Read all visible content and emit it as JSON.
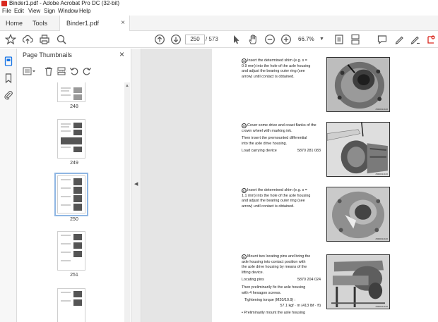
{
  "window": {
    "title": "Binder1.pdf - Adobe Acrobat Pro DC (32-bit)"
  },
  "menu": [
    "File",
    "Edit",
    "View",
    "Sign",
    "Window",
    "Help"
  ],
  "tabs": {
    "home": "Home",
    "tools": "Tools",
    "document": "Binder1.pdf",
    "close_glyph": "×"
  },
  "toolbar": {
    "current_page": "250",
    "total_pages": "/ 573",
    "zoom": "66.7%",
    "icons": [
      "star-icon",
      "upload-icon",
      "print-icon",
      "search-icon",
      "page-up-icon",
      "page-down-icon",
      "select-cursor-icon",
      "hand-icon",
      "zoom-out-icon",
      "zoom-in-icon",
      "fit-page-icon",
      "scroll-mode-icon",
      "comment-icon",
      "highlight-icon",
      "sign-icon",
      "share-icon"
    ]
  },
  "sidebar": {
    "title": "Page Thumbnails",
    "close_glyph": "×",
    "thumbnails": [
      {
        "label": "248"
      },
      {
        "label": "249"
      },
      {
        "label": "250",
        "selected": true
      },
      {
        "label": "251"
      },
      {
        "label": ""
      }
    ]
  },
  "document": {
    "steps": [
      {
        "number": "38",
        "lines": [
          "Insert the determined shim (e.g. s =",
          "0.9 mm) into the hole of the axle housing",
          "and adjust the bearing outer ring (see",
          "arrow) until contact is obtained."
        ],
        "photo_code": "ZSB0014100"
      },
      {
        "number": "39",
        "lines": [
          "Cover some drive and coast flanks of the",
          "crown wheel with marking ink."
        ],
        "para2": [
          "Then insert the premounted differential",
          "into the axle drive housing."
        ],
        "device_label": "Load carrying device",
        "device_value": "5870 281 083",
        "photo_code": "ZSB0014100"
      },
      {
        "number": "40",
        "lines": [
          "Insert the determined shim (e.g. s =",
          "1.1 mm) into the hole of the axle housing",
          "and adjust the bearing outer ring (see",
          "arrow) until contact is obtained."
        ],
        "photo_code": "ZSB0014100"
      },
      {
        "number": "41",
        "lines": [
          "Mount two locating pins and bring the",
          "axle housing into contact position with",
          "the axle drive housing by means of the",
          "lifting device."
        ],
        "device_label": "Locating pins",
        "device_value": "5870 204 024",
        "para2": [
          "Then preliminarily fix the axle housing",
          "with 4 hexagon screws."
        ],
        "torque_label": "Tightening torque (M20/10.9) :",
        "torque_value": "57.1 kgf · m (413 lbf · ft)",
        "bullet": "Preliminarily mount the axle housing",
        "photo_code": "ZSB0014100"
      }
    ]
  },
  "colors": {
    "acrobat_red": "#d9281f",
    "selection_blue": "#8fb6e3",
    "icon_grey": "#555555"
  }
}
